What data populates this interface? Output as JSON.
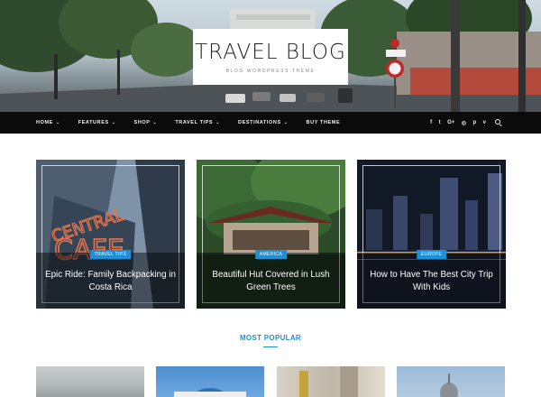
{
  "site": {
    "title": "TRAVEL BLOG",
    "tagline": "BLOG WORDPRESS THEME"
  },
  "nav": {
    "items": [
      {
        "label": "HOME",
        "has_dropdown": true
      },
      {
        "label": "FEATURES",
        "has_dropdown": true
      },
      {
        "label": "SHOP",
        "has_dropdown": true
      },
      {
        "label": "TRAVEL TIPS",
        "has_dropdown": true
      },
      {
        "label": "DESTINATIONS",
        "has_dropdown": true
      },
      {
        "label": "BUY THEME",
        "has_dropdown": false
      }
    ],
    "dropdown_glyph": "⌄",
    "social": [
      {
        "name": "facebook-icon",
        "glyph": "f"
      },
      {
        "name": "twitter-icon",
        "glyph": "t"
      },
      {
        "name": "google-plus-icon",
        "glyph": "G+"
      },
      {
        "name": "instagram-icon",
        "glyph": "◎"
      },
      {
        "name": "pinterest-icon",
        "glyph": "p"
      },
      {
        "name": "vimeo-icon",
        "glyph": "v"
      }
    ]
  },
  "featured": [
    {
      "category": "TRAVEL TIPS",
      "title": "Epic Ride: Family Backpacking in Costa Rica"
    },
    {
      "category": "AMERICA",
      "title": "Beautiful Hut Covered in Lush Green Trees"
    },
    {
      "category": "EUROPE",
      "title": "How to Have The Best City Trip With Kids"
    }
  ],
  "popular": {
    "heading": "MOST POPULAR"
  },
  "colors": {
    "accent": "#1e90d6",
    "nav_bg": "#0b0b0b"
  }
}
